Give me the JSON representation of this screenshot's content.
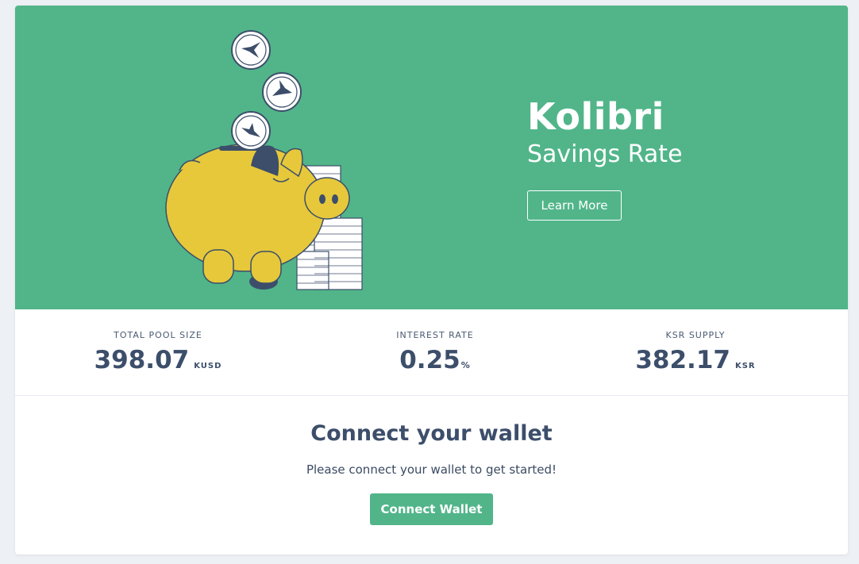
{
  "hero": {
    "title": "Kolibri",
    "subtitle": "Savings Rate",
    "learn_more_label": "Learn More",
    "background_color": "#51b589"
  },
  "stats": [
    {
      "label": "TOTAL POOL SIZE",
      "value": "398.07",
      "unit": "KUSD"
    },
    {
      "label": "INTEREST RATE",
      "value": "0.25",
      "unit": "%"
    },
    {
      "label": "KSR SUPPLY",
      "value": "382.17",
      "unit": "KSR"
    }
  ],
  "connect": {
    "title": "Connect your wallet",
    "subtitle": "Please connect your wallet to get started!",
    "button_label": "Connect Wallet"
  },
  "colors": {
    "accent": "#51b589",
    "text_dark": "#3c4e6a",
    "piggy": "#e6c83a"
  }
}
